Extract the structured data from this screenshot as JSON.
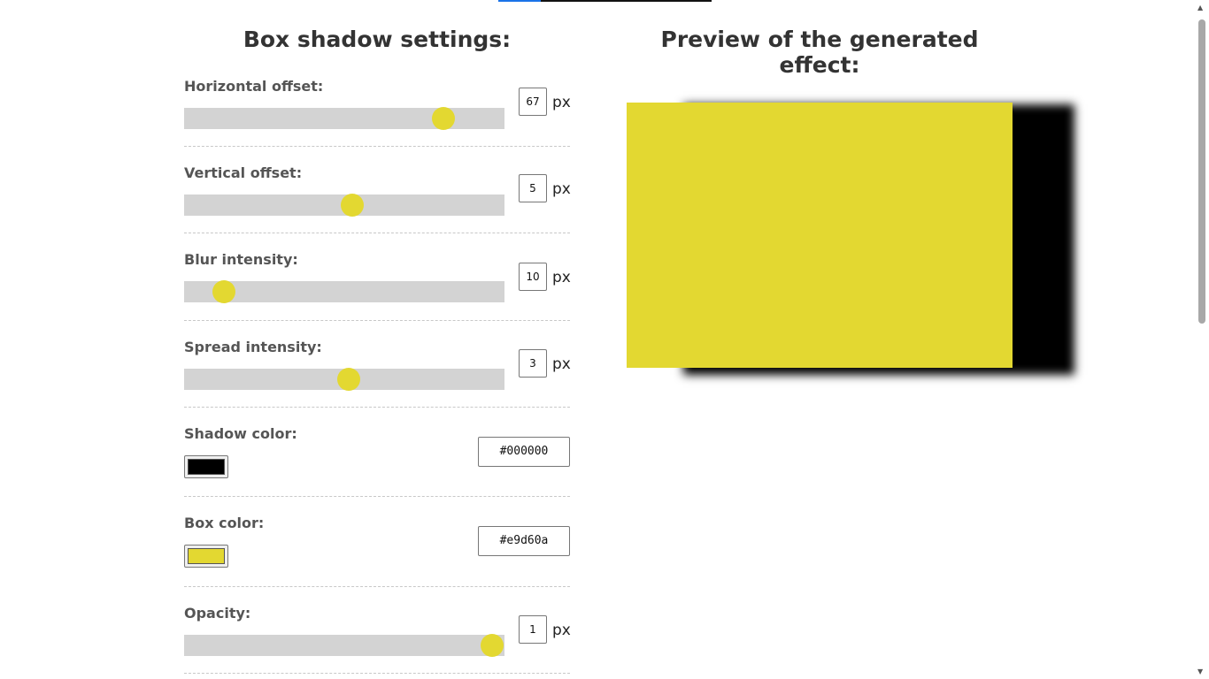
{
  "settings": {
    "title": "Box shadow settings:",
    "horizontal": {
      "label": "Horizontal offset:",
      "value": "67",
      "unit": "px",
      "fraction": 0.81
    },
    "vertical": {
      "label": "Vertical offset:",
      "value": "5",
      "unit": "px",
      "fraction": 0.525
    },
    "blur": {
      "label": "Blur intensity:",
      "value": "10",
      "unit": "px",
      "fraction": 0.125
    },
    "spread": {
      "label": "Spread intensity:",
      "value": "3",
      "unit": "px",
      "fraction": 0.514
    },
    "shadow_color": {
      "label": "Shadow color:",
      "value": "#000000",
      "color": "#000000"
    },
    "box_color": {
      "label": "Box color:",
      "value": "#e9d60a",
      "color": "#e3d831"
    },
    "opacity": {
      "label": "Opacity:",
      "value": "1",
      "unit": "px",
      "fraction": 0.96
    }
  },
  "preview": {
    "title": "Preview of the generated effect:",
    "box_color": "#e3d831",
    "shadow_color": "#000000"
  },
  "colors": {
    "accent": "#e3d831",
    "track": "#d3d3d3"
  }
}
